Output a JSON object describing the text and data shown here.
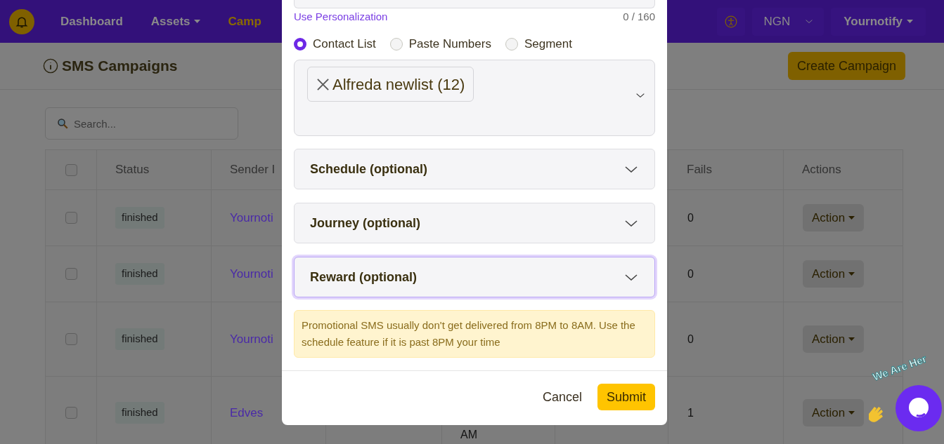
{
  "navbar": {
    "items": [
      {
        "label": "Dashboard",
        "dropdown": false,
        "selected": false
      },
      {
        "label": "Assets",
        "dropdown": true,
        "selected": false
      },
      {
        "label": "Camp",
        "dropdown": false,
        "selected": true
      }
    ],
    "currency": "NGN",
    "account": "Yournotify"
  },
  "page": {
    "title": "SMS Campaigns",
    "create_button": "Create Campaign",
    "search": {
      "placeholder": "Search..."
    }
  },
  "table": {
    "header_checked": false,
    "columns": [
      "Status",
      "Sender I",
      "",
      "",
      "",
      "Fails",
      "Actions"
    ],
    "rows": [
      {
        "checked": false,
        "status": "finished",
        "sender": "Yournoti",
        "column_4": "",
        "fails": "0",
        "action": "Action"
      },
      {
        "checked": false,
        "status": "finished",
        "sender": "Yournoti",
        "column_4": "",
        "fails": "0",
        "action": "Action"
      },
      {
        "checked": false,
        "status": "finished",
        "sender": "Yournoti",
        "column_4": "",
        "fails": "0",
        "action": "Action"
      },
      {
        "checked": false,
        "status": "finished",
        "sender": "Edves",
        "column_4": "AM",
        "fails": "1",
        "action": "Action"
      }
    ]
  },
  "modal": {
    "personalization_link": "Use Personalization",
    "char_count": "0 / 160",
    "recipient_types": [
      {
        "label": "Contact List",
        "selected": true
      },
      {
        "label": "Paste Numbers",
        "selected": false
      },
      {
        "label": "Segment",
        "selected": false
      }
    ],
    "selected_lists": [
      {
        "label": "Alfreda newlist (12)"
      }
    ],
    "sections": [
      {
        "title": "Schedule",
        "hint": "(optional)",
        "focused": false
      },
      {
        "title": "Journey",
        "hint": "(optional)",
        "focused": false
      },
      {
        "title": "Reward",
        "hint": "(optional)",
        "focused": true
      }
    ],
    "alert": "Promotional SMS usually don't get delivered from 8PM to 8AM. Use the schedule feature if it is past 8PM your time",
    "cancel": "Cancel",
    "submit": "Submit"
  },
  "chat_widget": {
    "label": "We Are Her"
  }
}
